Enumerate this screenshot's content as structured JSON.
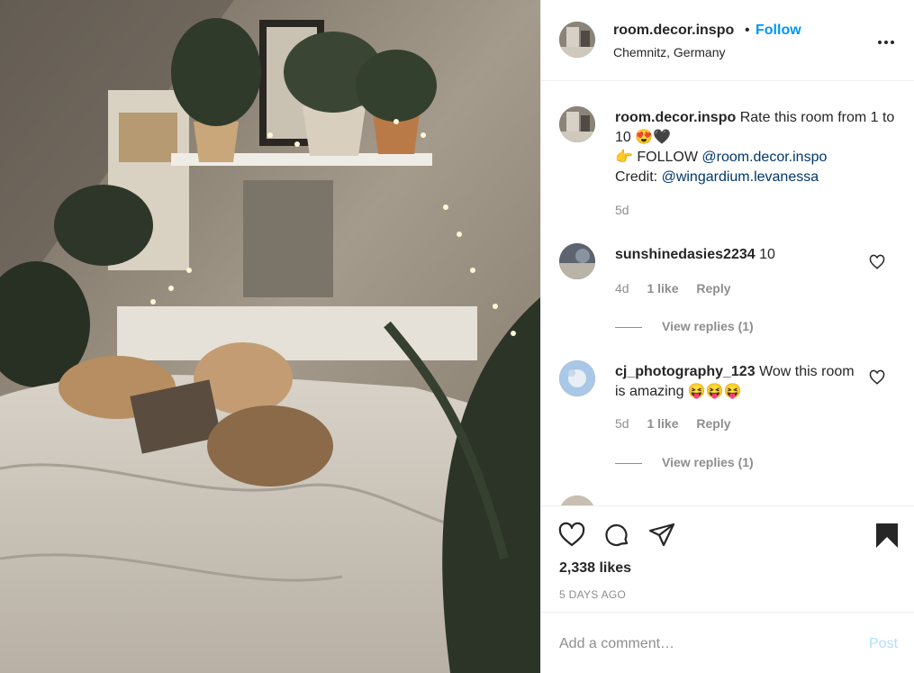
{
  "header": {
    "username": "room.decor.inspo",
    "separator": "•",
    "follow_label": "Follow",
    "location": "Chemnitz, Germany"
  },
  "caption": {
    "username": "room.decor.inspo",
    "text_part1": "Rate this room from 1 to 10 😍🖤",
    "text_follow": "👉 FOLLOW",
    "mention1": "@room.decor.inspo",
    "credit_label": "Credit:",
    "mention2": "@wingardium.levanessa",
    "time": "5d"
  },
  "comments": [
    {
      "username": "sunshinedasies2234",
      "text": "10",
      "time": "4d",
      "likes": "1 like",
      "reply": "Reply",
      "view_replies": "View replies (1)"
    },
    {
      "username": "cj_photography_123",
      "text": "Wow this room is amazing 😝😝😝",
      "time": "5d",
      "likes": "1 like",
      "reply": "Reply",
      "view_replies": "View replies (1)"
    }
  ],
  "post": {
    "likes": "2,338 likes",
    "posted": "5 DAYS AGO"
  },
  "add_comment": {
    "placeholder": "Add a comment…",
    "post_label": "Post"
  },
  "colors": {
    "accent": "#0095f6",
    "mention": "#00376b",
    "muted": "#8e8e8e",
    "post_disabled": "#b2dffc"
  }
}
